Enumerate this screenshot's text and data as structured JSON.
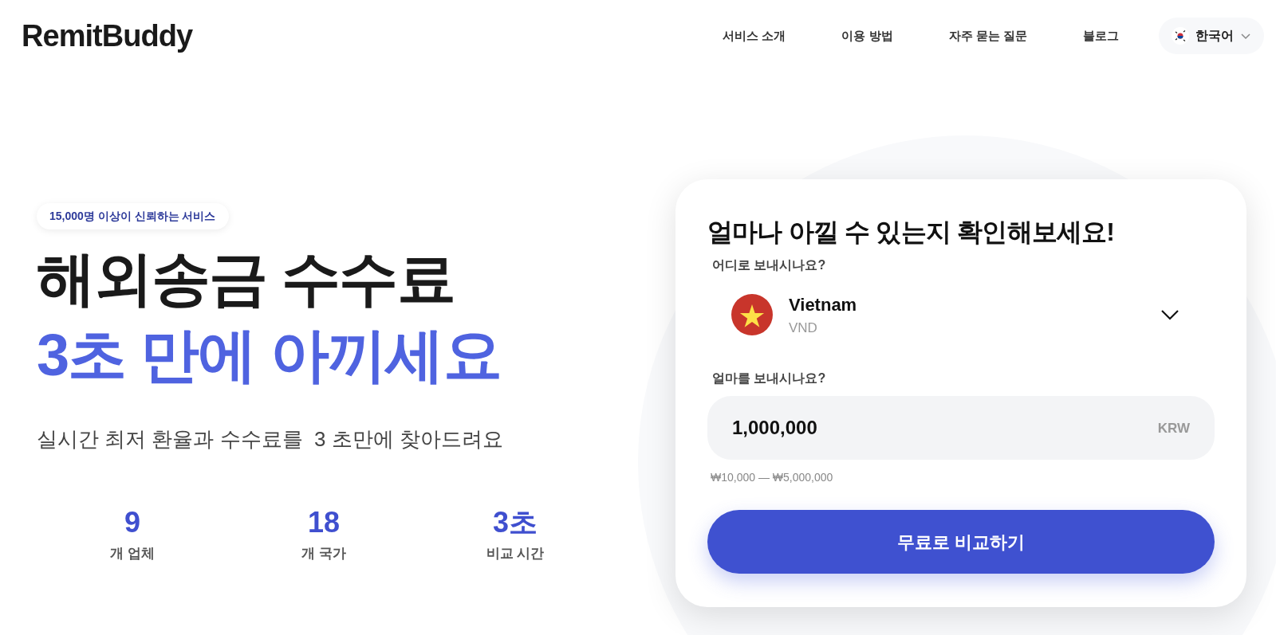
{
  "header": {
    "logo": "RemitBuddy",
    "nav": [
      "서비스 소개",
      "이용 방법",
      "자주 묻는 질문",
      "블로그"
    ],
    "language": {
      "label": "한국어"
    }
  },
  "hero": {
    "badge": "15,000명 이상이 신뢰하는 서비스",
    "headline_line1": "해외송금 수수료",
    "headline_line2": "3초 만에 아끼세요",
    "subtitle": "실시간 최저 환율과 수수료를  3 초만에 찾아드려요",
    "stats": [
      {
        "value": "9",
        "label": "개 업체"
      },
      {
        "value": "18",
        "label": "개 국가"
      },
      {
        "value": "3초",
        "label": "비교 시간"
      }
    ]
  },
  "card": {
    "title": "얼마나 아낄 수 있는지 확인해보세요!",
    "destination_label": "어디로 보내시나요?",
    "country": {
      "name": "Vietnam",
      "currency": "VND"
    },
    "amount_label": "얼마를 보내시나요?",
    "amount": {
      "value": "1,000,000",
      "currency": "KRW"
    },
    "range": "₩10,000 — ₩5,000,000",
    "button": "무료로 비교하기"
  }
}
